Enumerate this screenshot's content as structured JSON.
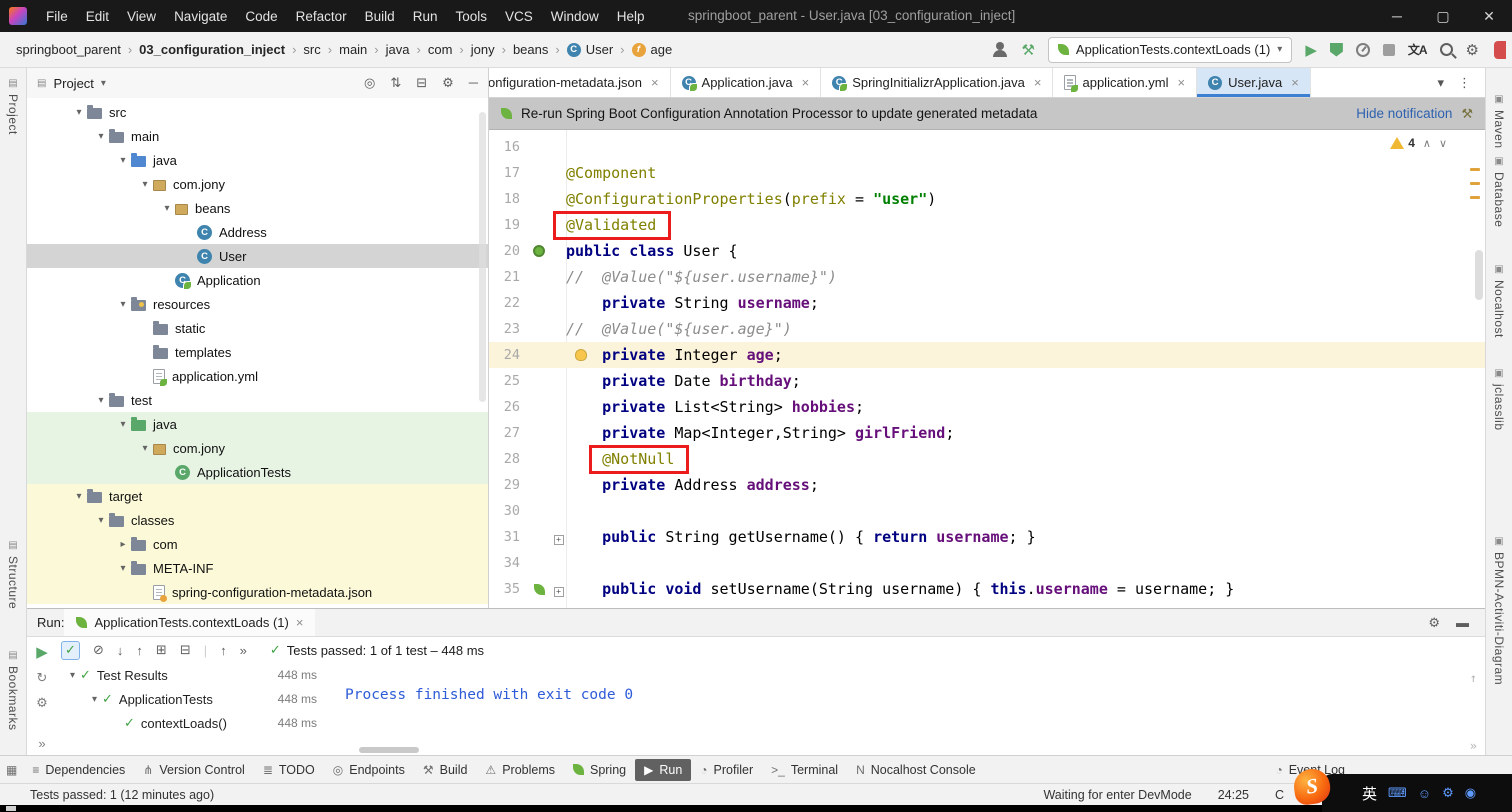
{
  "titlebar": {
    "menus": [
      "File",
      "Edit",
      "View",
      "Navigate",
      "Code",
      "Refactor",
      "Build",
      "Run",
      "Tools",
      "VCS",
      "Window",
      "Help"
    ],
    "title": "springboot_parent - User.java [03_configuration_inject]"
  },
  "breadcrumbs": {
    "items": [
      {
        "label": "springboot_parent",
        "bold": false,
        "icon": ""
      },
      {
        "label": "03_configuration_inject",
        "bold": true,
        "icon": ""
      },
      {
        "label": "src",
        "bold": false,
        "icon": ""
      },
      {
        "label": "main",
        "bold": false,
        "icon": ""
      },
      {
        "label": "java",
        "bold": false,
        "icon": ""
      },
      {
        "label": "com",
        "bold": false,
        "icon": ""
      },
      {
        "label": "jony",
        "bold": false,
        "icon": ""
      },
      {
        "label": "beans",
        "bold": false,
        "icon": ""
      },
      {
        "label": "User",
        "bold": false,
        "icon": "class"
      },
      {
        "label": "age",
        "bold": false,
        "icon": "field"
      }
    ]
  },
  "run_widget": {
    "config": "ApplicationTests.contextLoads (1)"
  },
  "stripes": {
    "left": [
      "Project",
      "Structure",
      "Bookmarks"
    ],
    "right": [
      "Maven",
      "Database",
      "Nocalhost",
      "jclasslib",
      "BPMN-Activiti-Diagram"
    ]
  },
  "project": {
    "header": "Project",
    "tree": [
      {
        "label": "src",
        "level": 0,
        "chev": "v",
        "icon": "folder",
        "bg": ""
      },
      {
        "label": "main",
        "level": 1,
        "chev": "v",
        "icon": "folder",
        "bg": ""
      },
      {
        "label": "java",
        "level": 2,
        "chev": "v",
        "icon": "folder-java",
        "bg": ""
      },
      {
        "label": "com.jony",
        "level": 3,
        "chev": "v",
        "icon": "package",
        "bg": ""
      },
      {
        "label": "beans",
        "level": 4,
        "chev": "v",
        "icon": "package",
        "bg": ""
      },
      {
        "label": "Address",
        "level": 5,
        "chev": "",
        "icon": "class",
        "bg": ""
      },
      {
        "label": "User",
        "level": 5,
        "chev": "",
        "icon": "class",
        "bg": "sel"
      },
      {
        "label": "Application",
        "level": 4,
        "chev": "",
        "icon": "class-spring",
        "bg": ""
      },
      {
        "label": "resources",
        "level": 2,
        "chev": "v",
        "icon": "folder-res",
        "bg": ""
      },
      {
        "label": "static",
        "level": 3,
        "chev": "",
        "icon": "folder",
        "bg": ""
      },
      {
        "label": "templates",
        "level": 3,
        "chev": "",
        "icon": "folder",
        "bg": ""
      },
      {
        "label": "application.yml",
        "level": 3,
        "chev": "",
        "icon": "file-yml",
        "bg": ""
      },
      {
        "label": "test",
        "level": 1,
        "chev": "v",
        "icon": "folder",
        "bg": ""
      },
      {
        "label": "java",
        "level": 2,
        "chev": "v",
        "icon": "folder-test",
        "bg": "green"
      },
      {
        "label": "com.jony",
        "level": 3,
        "chev": "v",
        "icon": "package",
        "bg": "green"
      },
      {
        "label": "ApplicationTests",
        "level": 4,
        "chev": "",
        "icon": "class-test",
        "bg": "green"
      },
      {
        "label": "target",
        "level": 0,
        "chev": "v",
        "icon": "folder",
        "bg": "yellow"
      },
      {
        "label": "classes",
        "level": 1,
        "chev": "v",
        "icon": "folder",
        "bg": "yellow"
      },
      {
        "label": "com",
        "level": 2,
        "chev": ">",
        "icon": "folder",
        "bg": "yellow"
      },
      {
        "label": "META-INF",
        "level": 2,
        "chev": "v",
        "icon": "folder",
        "bg": "yellow"
      },
      {
        "label": "spring-configuration-metadata.json",
        "level": 3,
        "chev": "",
        "icon": "file-json",
        "bg": "yellow"
      }
    ]
  },
  "editor_tabs": {
    "tabs": [
      {
        "label": "onfiguration-metadata.json",
        "icon": "",
        "active": false,
        "cut": true
      },
      {
        "label": "Application.java",
        "icon": "class-spring",
        "active": false,
        "cut": false
      },
      {
        "label": "SpringInitializrApplication.java",
        "icon": "class-spring",
        "active": false,
        "cut": false
      },
      {
        "label": "application.yml",
        "icon": "yml",
        "active": false,
        "cut": false
      },
      {
        "label": "User.java",
        "icon": "class",
        "active": true,
        "cut": false
      }
    ]
  },
  "notification": {
    "text": "Re-run Spring Boot Configuration Annotation Processor to update generated metadata",
    "action": "Hide notification"
  },
  "editor": {
    "warning_count": "4",
    "lines": [
      {
        "n": "16",
        "parts": []
      },
      {
        "n": "17",
        "parts": [
          [
            "@Component",
            "a"
          ]
        ]
      },
      {
        "n": "18",
        "parts": [
          [
            "@ConfigurationProperties",
            "a"
          ],
          [
            "(",
            "p"
          ],
          [
            "prefix",
            "a"
          ],
          [
            " = ",
            "p"
          ],
          [
            "\"user\"",
            "s"
          ],
          [
            ")",
            "p"
          ]
        ]
      },
      {
        "n": "19",
        "parts": [
          [
            "@Validated",
            "a",
            "box"
          ]
        ]
      },
      {
        "n": "20",
        "parts": [
          [
            "public class ",
            "k"
          ],
          [
            "User {",
            "p"
          ]
        ],
        "gicon": "bean"
      },
      {
        "n": "21",
        "parts": [
          [
            "//  @Value(\"${user.username}\")",
            "c"
          ]
        ]
      },
      {
        "n": "22",
        "parts": [
          [
            "    ",
            "p"
          ],
          [
            "private ",
            "k"
          ],
          [
            "String ",
            "p"
          ],
          [
            "username",
            "f"
          ],
          [
            ";",
            "p"
          ]
        ]
      },
      {
        "n": "23",
        "parts": [
          [
            "//  @Value(\"${user.age}\")",
            "c"
          ]
        ]
      },
      {
        "n": "24",
        "parts": [
          [
            "    ",
            "p"
          ],
          [
            "private ",
            "k"
          ],
          [
            "Integer ",
            "p"
          ],
          [
            "age",
            "f"
          ],
          [
            ";",
            "p"
          ]
        ],
        "hl": true,
        "bulb": true
      },
      {
        "n": "25",
        "parts": [
          [
            "    ",
            "p"
          ],
          [
            "private ",
            "k"
          ],
          [
            "Date ",
            "p"
          ],
          [
            "birthday",
            "f"
          ],
          [
            ";",
            "p"
          ]
        ]
      },
      {
        "n": "26",
        "parts": [
          [
            "    ",
            "p"
          ],
          [
            "private ",
            "k"
          ],
          [
            "List<String> ",
            "p"
          ],
          [
            "hobbies",
            "f"
          ],
          [
            ";",
            "p"
          ]
        ]
      },
      {
        "n": "27",
        "parts": [
          [
            "    ",
            "p"
          ],
          [
            "private ",
            "k"
          ],
          [
            "Map<Integer,String> ",
            "p"
          ],
          [
            "girlFriend",
            "f"
          ],
          [
            ";",
            "p"
          ]
        ]
      },
      {
        "n": "28",
        "parts": [
          [
            "    ",
            "p"
          ],
          [
            "@NotNull",
            "a",
            "box"
          ]
        ]
      },
      {
        "n": "29",
        "parts": [
          [
            "    ",
            "p"
          ],
          [
            "private ",
            "k"
          ],
          [
            "Address ",
            "p"
          ],
          [
            "address",
            "f"
          ],
          [
            ";",
            "p"
          ]
        ]
      },
      {
        "n": "30",
        "parts": []
      },
      {
        "n": "31",
        "parts": [
          [
            "    ",
            "p"
          ],
          [
            "public ",
            "k"
          ],
          [
            "String getUsername() { ",
            "p"
          ],
          [
            "return ",
            "k"
          ],
          [
            "username",
            "f"
          ],
          [
            "; }",
            "p"
          ]
        ],
        "fold": true
      },
      {
        "n": "34",
        "parts": []
      },
      {
        "n": "35",
        "parts": [
          [
            "    ",
            "p"
          ],
          [
            "public void ",
            "k"
          ],
          [
            "setUsername(String username) { ",
            "p"
          ],
          [
            "this",
            "k"
          ],
          [
            ".",
            "p"
          ],
          [
            "username",
            "f"
          ],
          [
            " = username; }",
            "p"
          ]
        ],
        "fold": true,
        "gicon": "leaf"
      }
    ]
  },
  "run_panel": {
    "label": "Run:",
    "tab": "ApplicationTests.contextLoads (1)",
    "status": "Tests passed: 1 of 1 test – 448 ms",
    "console": "Process finished with exit code 0",
    "tree": [
      {
        "label": "Test Results",
        "time": "448 ms",
        "level": 0,
        "chev": true
      },
      {
        "label": "ApplicationTests",
        "time": "448 ms",
        "level": 1,
        "chev": true
      },
      {
        "label": "contextLoads()",
        "time": "448 ms",
        "level": 2,
        "chev": false
      }
    ]
  },
  "bottom_bar": {
    "items": [
      {
        "label": "Dependencies",
        "icon": "deps"
      },
      {
        "label": "Version Control",
        "icon": "vcs"
      },
      {
        "label": "TODO",
        "icon": "todo"
      },
      {
        "label": "Endpoints",
        "icon": "endpoints"
      },
      {
        "label": "Build",
        "icon": "build"
      },
      {
        "label": "Problems",
        "icon": "problems"
      },
      {
        "label": "Spring",
        "icon": "spring"
      },
      {
        "label": "Run",
        "icon": "run"
      },
      {
        "label": "Profiler",
        "icon": "profiler"
      },
      {
        "label": "Terminal",
        "icon": "terminal"
      },
      {
        "label": "Nocalhost Console",
        "icon": "nocalhost"
      }
    ],
    "active": "Run",
    "right_item": "Event Log"
  },
  "status_bar": {
    "left": "Tests passed: 1 (12 minutes ago)",
    "devmode": "Waiting for enter DevMode",
    "position": "24:25",
    "fragment": "C"
  },
  "ime": {
    "lang": "英"
  },
  "colors": {
    "keyword": "#000080",
    "annotation": "#808000",
    "string": "#008000",
    "comment": "#8c8c8c",
    "field": "#660e7a",
    "selection": "#d4d4d4",
    "test_scope_bg": "#e7f3e3",
    "generated_scope_bg": "#fbf9d7",
    "active_tab": "#d7e6f7",
    "tab_underline": "#3d7fd1",
    "annotation_box_red": "#ec1c1c",
    "run_green": "#59a869",
    "spring_green": "#6db33f",
    "console_info_blue": "#2e5bd7",
    "notification_bg": "#c6c6c6",
    "titlebar_bg": "#191919"
  }
}
